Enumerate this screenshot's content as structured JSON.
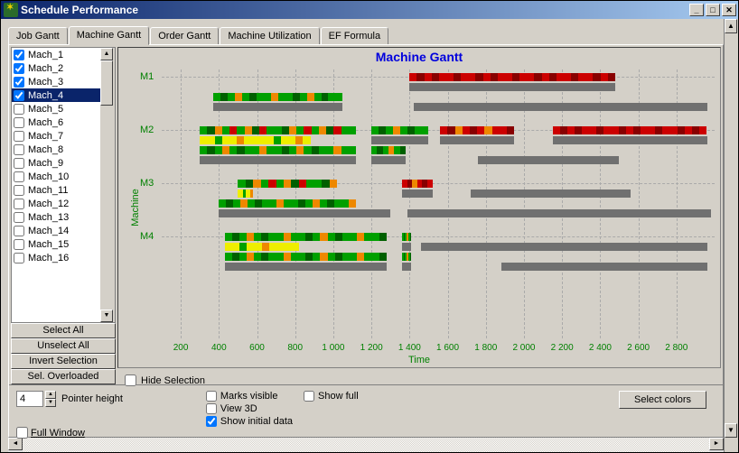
{
  "window": {
    "title": "Schedule Performance"
  },
  "tabs": [
    "Job Gantt",
    "Machine Gantt",
    "Order Gantt",
    "Machine Utilization",
    "EF Formula"
  ],
  "active_tab": 1,
  "machines": [
    {
      "label": "Mach_1",
      "checked": true
    },
    {
      "label": "Mach_2",
      "checked": true
    },
    {
      "label": "Mach_3",
      "checked": true
    },
    {
      "label": "Mach_4",
      "checked": true,
      "selected": true
    },
    {
      "label": "Mach_5",
      "checked": false
    },
    {
      "label": "Mach_6",
      "checked": false
    },
    {
      "label": "Mach_7",
      "checked": false
    },
    {
      "label": "Mach_8",
      "checked": false
    },
    {
      "label": "Mach_9",
      "checked": false
    },
    {
      "label": "Mach_10",
      "checked": false
    },
    {
      "label": "Mach_11",
      "checked": false
    },
    {
      "label": "Mach_12",
      "checked": false
    },
    {
      "label": "Mach_13",
      "checked": false
    },
    {
      "label": "Mach_14",
      "checked": false
    },
    {
      "label": "Mach_15",
      "checked": false
    },
    {
      "label": "Mach_16",
      "checked": false
    }
  ],
  "sel_buttons": [
    "Select All",
    "Unselect All",
    "Invert Selection",
    "Sel. Overloaded"
  ],
  "hide_selection_label": "Hide Selection",
  "chart_data": {
    "type": "gantt",
    "title": "Machine Gantt",
    "ylabel": "Machine",
    "xlabel": "Time",
    "x_ticks": [
      200,
      400,
      600,
      800,
      "1 000",
      "1 200",
      "1 400",
      "1 600",
      "1 800",
      "2 000",
      "2 200",
      "2 400",
      "2 600",
      "2 800"
    ],
    "x_range": [
      100,
      3000
    ],
    "y_categories": [
      "M1",
      "M2",
      "M3",
      "M4"
    ],
    "rows": [
      {
        "machine": "M1",
        "track": 0,
        "bars": [
          {
            "x0": 1400,
            "x1": 2480,
            "kind": "color",
            "pattern": "red"
          }
        ]
      },
      {
        "machine": "M1",
        "track": 1,
        "bars": [
          {
            "x0": 1400,
            "x1": 2480,
            "kind": "gray"
          }
        ]
      },
      {
        "machine": "M1",
        "track": 2,
        "bars": [
          {
            "x0": 370,
            "x1": 1050,
            "kind": "color",
            "pattern": "greenmix"
          }
        ]
      },
      {
        "machine": "M1",
        "track": 3,
        "bars": [
          {
            "x0": 370,
            "x1": 1050,
            "kind": "gray"
          },
          {
            "x0": 1420,
            "x1": 2960,
            "kind": "gray"
          }
        ]
      },
      {
        "machine": "M2",
        "track": 0,
        "bars": [
          {
            "x0": 300,
            "x1": 1120,
            "kind": "color",
            "pattern": "greenredmix"
          },
          {
            "x0": 1200,
            "x1": 1500,
            "kind": "color",
            "pattern": "greenmix"
          },
          {
            "x0": 1560,
            "x1": 1950,
            "kind": "color",
            "pattern": "redmix"
          },
          {
            "x0": 2150,
            "x1": 2960,
            "kind": "color",
            "pattern": "red"
          }
        ]
      },
      {
        "machine": "M2",
        "track": 1,
        "bars": [
          {
            "x0": 300,
            "x1": 880,
            "kind": "color",
            "pattern": "yellowmix"
          },
          {
            "x0": 1200,
            "x1": 1500,
            "kind": "gray"
          },
          {
            "x0": 1560,
            "x1": 1950,
            "kind": "gray"
          },
          {
            "x0": 2150,
            "x1": 2960,
            "kind": "gray"
          }
        ]
      },
      {
        "machine": "M2",
        "track": 2,
        "bars": [
          {
            "x0": 300,
            "x1": 1120,
            "kind": "color",
            "pattern": "greenmix"
          },
          {
            "x0": 1200,
            "x1": 1380,
            "kind": "color",
            "pattern": "greenmix"
          }
        ]
      },
      {
        "machine": "M2",
        "track": 3,
        "bars": [
          {
            "x0": 300,
            "x1": 1120,
            "kind": "gray"
          },
          {
            "x0": 1200,
            "x1": 1380,
            "kind": "gray"
          },
          {
            "x0": 1760,
            "x1": 2500,
            "kind": "gray"
          }
        ]
      },
      {
        "machine": "M3",
        "track": 0,
        "bars": [
          {
            "x0": 500,
            "x1": 1020,
            "kind": "color",
            "pattern": "greenredmix"
          },
          {
            "x0": 1360,
            "x1": 1520,
            "kind": "color",
            "pattern": "redmix"
          }
        ]
      },
      {
        "machine": "M3",
        "track": 1,
        "bars": [
          {
            "x0": 500,
            "x1": 580,
            "kind": "color",
            "pattern": "yellowmix"
          },
          {
            "x0": 1360,
            "x1": 1520,
            "kind": "gray"
          },
          {
            "x0": 1720,
            "x1": 2560,
            "kind": "gray"
          }
        ]
      },
      {
        "machine": "M3",
        "track": 2,
        "bars": [
          {
            "x0": 400,
            "x1": 1120,
            "kind": "color",
            "pattern": "greenmix"
          }
        ]
      },
      {
        "machine": "M3",
        "track": 3,
        "bars": [
          {
            "x0": 400,
            "x1": 1300,
            "kind": "gray"
          },
          {
            "x0": 1390,
            "x1": 2980,
            "kind": "gray"
          }
        ]
      },
      {
        "machine": "M4",
        "track": 0,
        "bars": [
          {
            "x0": 430,
            "x1": 1280,
            "kind": "color",
            "pattern": "greenmix"
          },
          {
            "x0": 1360,
            "x1": 1410,
            "kind": "color",
            "pattern": "greenmix"
          }
        ]
      },
      {
        "machine": "M4",
        "track": 1,
        "bars": [
          {
            "x0": 430,
            "x1": 820,
            "kind": "color",
            "pattern": "yellowmix"
          },
          {
            "x0": 1360,
            "x1": 1410,
            "kind": "gray"
          },
          {
            "x0": 1460,
            "x1": 2960,
            "kind": "gray"
          }
        ]
      },
      {
        "machine": "M4",
        "track": 2,
        "bars": [
          {
            "x0": 430,
            "x1": 1280,
            "kind": "color",
            "pattern": "greenmix"
          },
          {
            "x0": 1360,
            "x1": 1410,
            "kind": "color",
            "pattern": "greenmix"
          }
        ]
      },
      {
        "machine": "M4",
        "track": 3,
        "bars": [
          {
            "x0": 430,
            "x1": 1280,
            "kind": "gray"
          },
          {
            "x0": 1360,
            "x1": 1410,
            "kind": "gray"
          },
          {
            "x0": 1880,
            "x1": 2960,
            "kind": "gray"
          }
        ]
      }
    ]
  },
  "footer": {
    "pointer_height_value": "4",
    "pointer_height_label": "Pointer height",
    "full_window_label": "Full Window",
    "marks_visible_label": "Marks visible",
    "view3d_label": "View 3D",
    "show_initial_label": "Show initial data",
    "show_full_label": "Show full",
    "select_colors_label": "Select colors"
  }
}
